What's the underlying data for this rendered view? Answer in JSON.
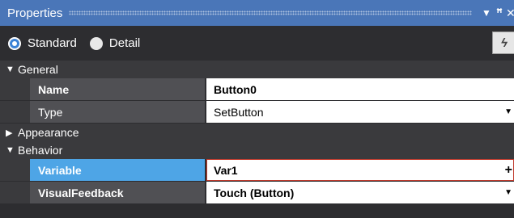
{
  "panel": {
    "title": "Properties"
  },
  "view_mode": {
    "options": [
      {
        "label": "Standard",
        "selected": true
      },
      {
        "label": "Detail",
        "selected": false
      }
    ]
  },
  "toolbar": {
    "event_button_glyph": "ϟ"
  },
  "categories": {
    "general": {
      "label": "General",
      "expanded": true
    },
    "appearance": {
      "label": "Appearance",
      "expanded": false
    },
    "behavior": {
      "label": "Behavior",
      "expanded": true
    }
  },
  "properties": {
    "name": {
      "label": "Name",
      "value": "Button0"
    },
    "type": {
      "label": "Type",
      "value": "SetButton"
    },
    "variable": {
      "label": "Variable",
      "value": "Var1"
    },
    "visual_feedback": {
      "label": "VisualFeedback",
      "value": "Touch (Button)"
    }
  },
  "colors": {
    "title_bar": "#4a76b8",
    "selected_property": "#4ea5e6",
    "active_value_border": "#c0392b"
  },
  "icons": {
    "title_dropdown": "chevron-down-icon",
    "title_pin": "pin-icon",
    "title_close": "close-icon",
    "value_dropdown": "dropdown-arrow-icon",
    "value_add": "plus-icon"
  }
}
